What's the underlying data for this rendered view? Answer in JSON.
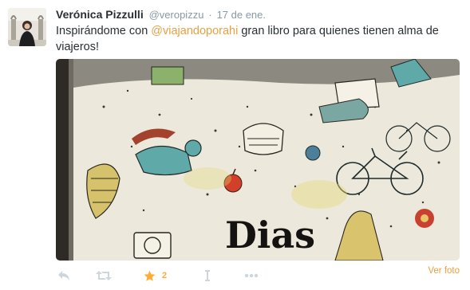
{
  "tweet": {
    "fullname": "Verónica Pizzulli",
    "username": "@veropizzu",
    "separator": "·",
    "time": "17 de ene.",
    "text_before": "Inspirándome con ",
    "mention": "@viajandoporahi",
    "text_after": " gran libro para quienes tienen alma de viajeros!",
    "media_text": "Dias",
    "view_photo": "Ver foto"
  },
  "actions": {
    "reply_icon": "reply-icon",
    "retweet_icon": "retweet-icon",
    "favorite_icon": "star-icon",
    "favorite_count": "2",
    "analytics_icon": "analytics-icon",
    "more_icon": "more-icon"
  },
  "colors": {
    "link": "#e8a041",
    "favorite": "#ffac33",
    "muted": "#8899a6",
    "icon": "#ccd6dd"
  }
}
